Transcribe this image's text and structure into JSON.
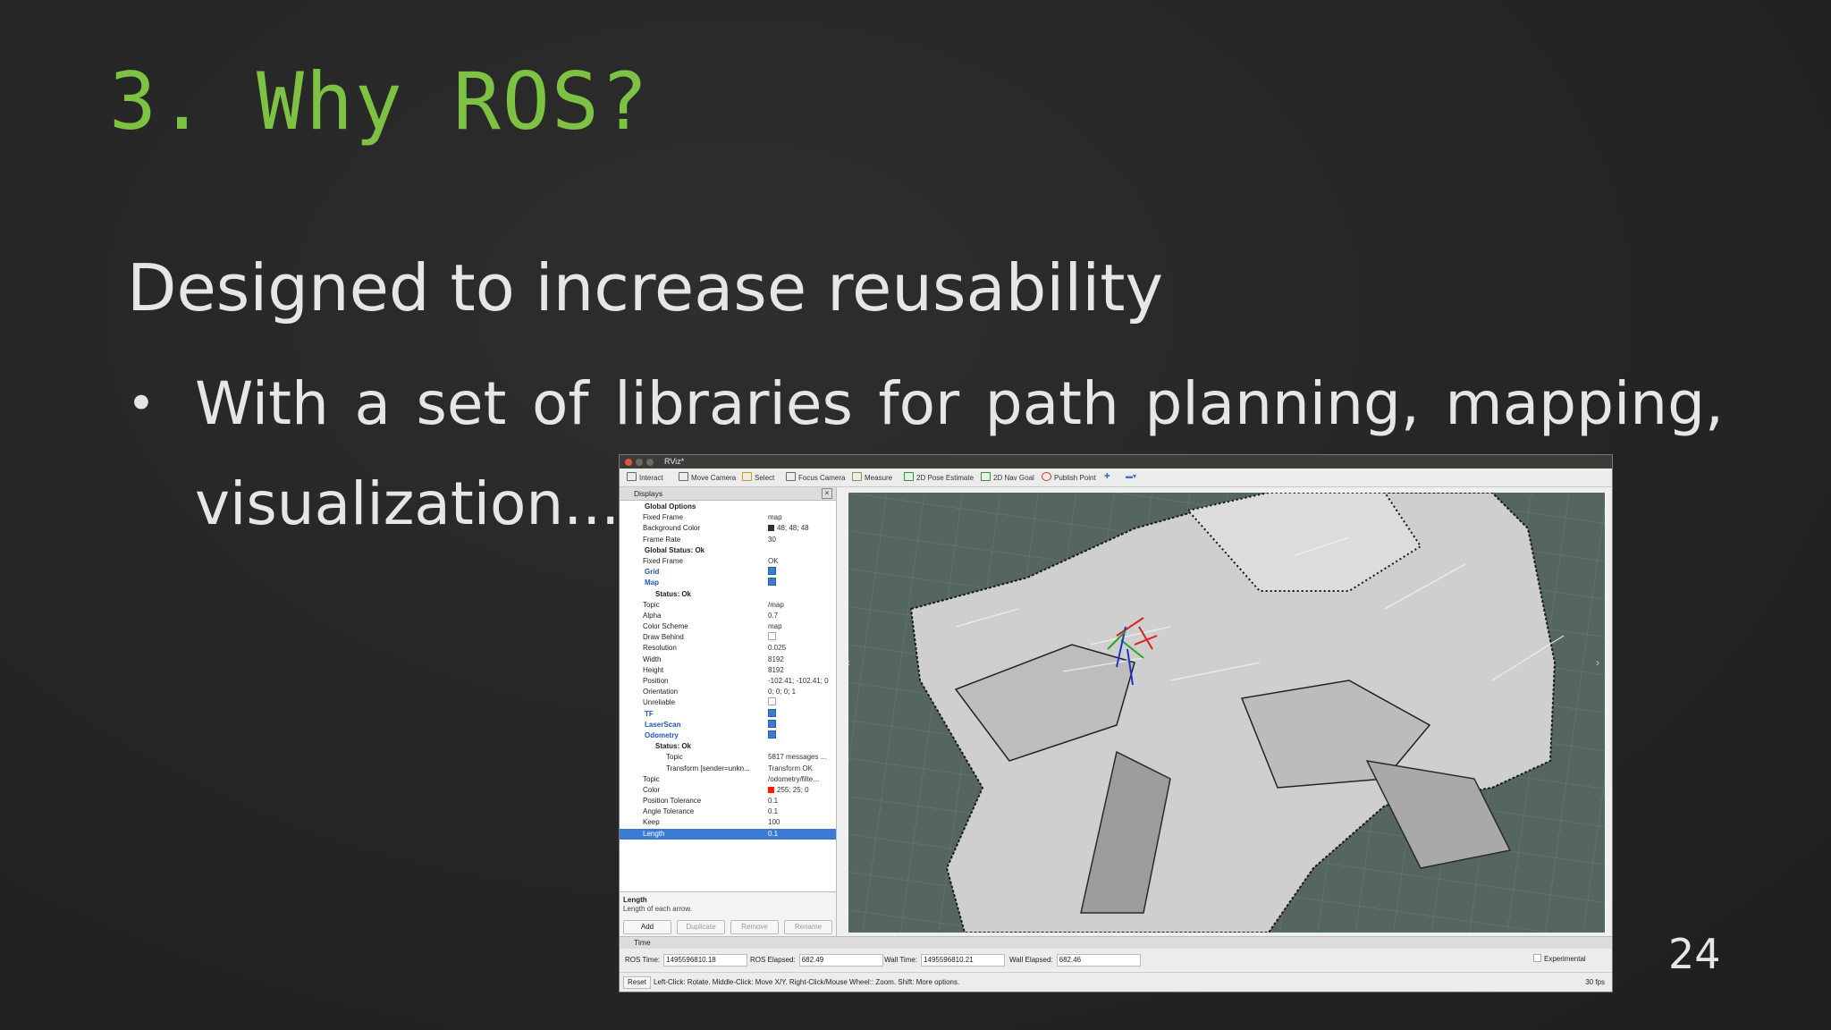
{
  "slide": {
    "title": "3. Why ROS?",
    "subtitle": "Designed to increase reusability",
    "bullet_line1": "With a set of libraries for path planning, mapping,",
    "bullet_line2": "visualization...",
    "page_number": "24"
  },
  "rviz": {
    "window_title": "RViz*",
    "toolbar": [
      "Interact",
      "Move Camera",
      "Select",
      "Focus Camera",
      "Measure",
      "2D Pose Estimate",
      "2D Nav Goal",
      "Publish Point"
    ],
    "displays_title": "Displays",
    "rows": [
      {
        "name": "Global Options",
        "value": "",
        "indent": 1
      },
      {
        "name": "Fixed Frame",
        "value": "map",
        "indent": 2
      },
      {
        "name": "Background Color",
        "value": "48; 48; 48",
        "indent": 2
      },
      {
        "name": "Frame Rate",
        "value": "30",
        "indent": 2
      },
      {
        "name": "Global Status: Ok",
        "value": "",
        "indent": 1
      },
      {
        "name": "Fixed Frame",
        "value": "OK",
        "indent": 2
      },
      {
        "name": "Grid",
        "value": "",
        "indent": 1
      },
      {
        "name": "Map",
        "value": "",
        "indent": 1
      },
      {
        "name": "Status: Ok",
        "value": "",
        "indent": 2
      },
      {
        "name": "Topic",
        "value": "/map",
        "indent": 2
      },
      {
        "name": "Alpha",
        "value": "0.7",
        "indent": 2
      },
      {
        "name": "Color Scheme",
        "value": "map",
        "indent": 2
      },
      {
        "name": "Draw Behind",
        "value": "",
        "indent": 2
      },
      {
        "name": "Resolution",
        "value": "0.025",
        "indent": 2
      },
      {
        "name": "Width",
        "value": "8192",
        "indent": 2
      },
      {
        "name": "Height",
        "value": "8192",
        "indent": 2
      },
      {
        "name": "Position",
        "value": "-102.41; -102.41; 0",
        "indent": 2
      },
      {
        "name": "Orientation",
        "value": "0; 0; 0; 1",
        "indent": 2
      },
      {
        "name": "Unreliable",
        "value": "",
        "indent": 2
      },
      {
        "name": "TF",
        "value": "",
        "indent": 1
      },
      {
        "name": "LaserScan",
        "value": "",
        "indent": 1
      },
      {
        "name": "Odometry",
        "value": "",
        "indent": 1
      },
      {
        "name": "Status: Ok",
        "value": "",
        "indent": 2
      },
      {
        "name": "Topic",
        "value": "5817 messages ...",
        "indent": 3
      },
      {
        "name": "Transform [sender=unkn...",
        "value": "Transform OK",
        "indent": 3
      },
      {
        "name": "Topic",
        "value": "/odometry/filte...",
        "indent": 2
      },
      {
        "name": "Color",
        "value": "255; 25; 0",
        "indent": 2
      },
      {
        "name": "Position Tolerance",
        "value": "0.1",
        "indent": 2
      },
      {
        "name": "Angle Tolerance",
        "value": "0.1",
        "indent": 2
      },
      {
        "name": "Keep",
        "value": "100",
        "indent": 2
      },
      {
        "name": "Length",
        "value": "0.1",
        "indent": 2
      }
    ],
    "help_title": "Length",
    "help_text": "Length of each arrow.",
    "buttons": [
      "Add",
      "Duplicate",
      "Remove",
      "Rename"
    ],
    "time_title": "Time",
    "ros_time_label": "ROS Time:",
    "ros_time": "1495596810.18",
    "ros_elapsed_label": "ROS Elapsed:",
    "ros_elapsed": "682.49",
    "wall_time_label": "Wall Time:",
    "wall_time": "1495596810.21",
    "wall_elapsed_label": "Wall Elapsed:",
    "wall_elapsed": "682.46",
    "experimental": "Experimental",
    "reset": "Reset",
    "status_msg": "Left-Click: Rotate. Middle-Click: Move X/Y. Right-Click/Mouse Wheel:: Zoom. Shift: More options.",
    "fps": "30 fps"
  }
}
